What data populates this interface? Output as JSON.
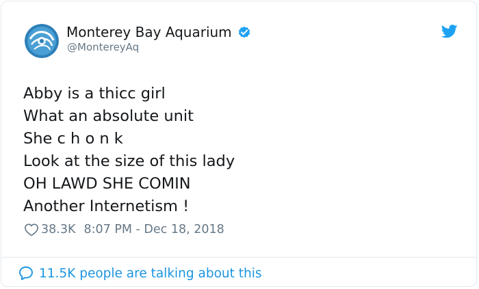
{
  "colors": {
    "text": "#14171a",
    "secondary": "#657786",
    "accent": "#1da1f2",
    "link": "#1b95e0",
    "border": "#e1e8ed"
  },
  "icons": {
    "avatar": "monterey-bay-aquarium-logo",
    "verified": "verified-badge-icon",
    "brand": "twitter-bird-icon",
    "like": "heart-outline-icon",
    "reply": "speech-bubble-icon"
  },
  "tweet": {
    "author_name": "Monterey Bay Aquarium",
    "author_handle": "@MontereyAq",
    "lines": [
      "Abby is a thicc girl",
      "What an absolute unit",
      "She c h o n k",
      "Look at the size of this lady",
      "OH LAWD SHE COMIN",
      "Another Internetism !"
    ],
    "like_count": "38.3K",
    "timestamp": "8:07 PM - Dec 18, 2018",
    "talking_text": "11.5K people are talking about this"
  }
}
